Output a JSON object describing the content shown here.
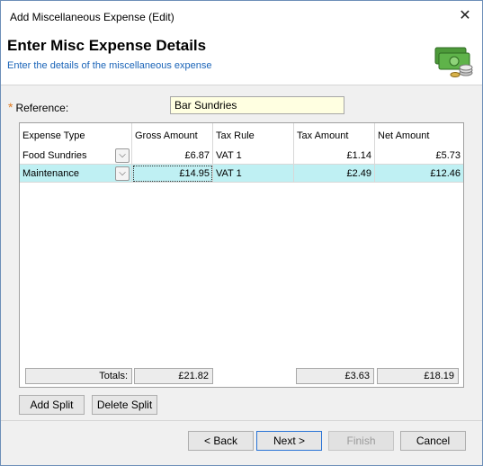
{
  "window": {
    "title": "Add Miscellaneous Expense (Edit)",
    "close_glyph": "✕"
  },
  "header": {
    "heading": "Enter Misc Expense Details",
    "subheading": "Enter the details of the miscellaneous expense"
  },
  "reference": {
    "required_marker": "*",
    "label": "Reference:",
    "value": "Bar Sundries"
  },
  "grid": {
    "columns": [
      "Expense Type",
      "Gross Amount",
      "Tax Rule",
      "Tax Amount",
      "Net Amount"
    ],
    "rows": [
      {
        "expense_type": "Food Sundries",
        "gross": "£6.87",
        "tax_rule": "VAT 1",
        "tax": "£1.14",
        "net": "£5.73",
        "selected": false
      },
      {
        "expense_type": "Maintenance",
        "gross": "£14.95",
        "tax_rule": "VAT 1",
        "tax": "£2.49",
        "net": "£12.46",
        "selected": true
      }
    ],
    "totals": {
      "label": "Totals:",
      "gross": "£21.82",
      "tax": "£3.63",
      "net": "£18.19"
    },
    "dropdown_glyph": "⌵"
  },
  "split_buttons": {
    "add": "Add Split",
    "delete": "Delete Split"
  },
  "nav_buttons": {
    "back": "< Back",
    "next": "Next >",
    "finish": "Finish",
    "cancel": "Cancel"
  },
  "colors": {
    "selected_row": "#bff0f3",
    "reference_bg": "#ffffe1",
    "subheading": "#1a64b8",
    "required": "#e07a1f"
  },
  "icons": {
    "header_icon": "money-stack-icon"
  }
}
